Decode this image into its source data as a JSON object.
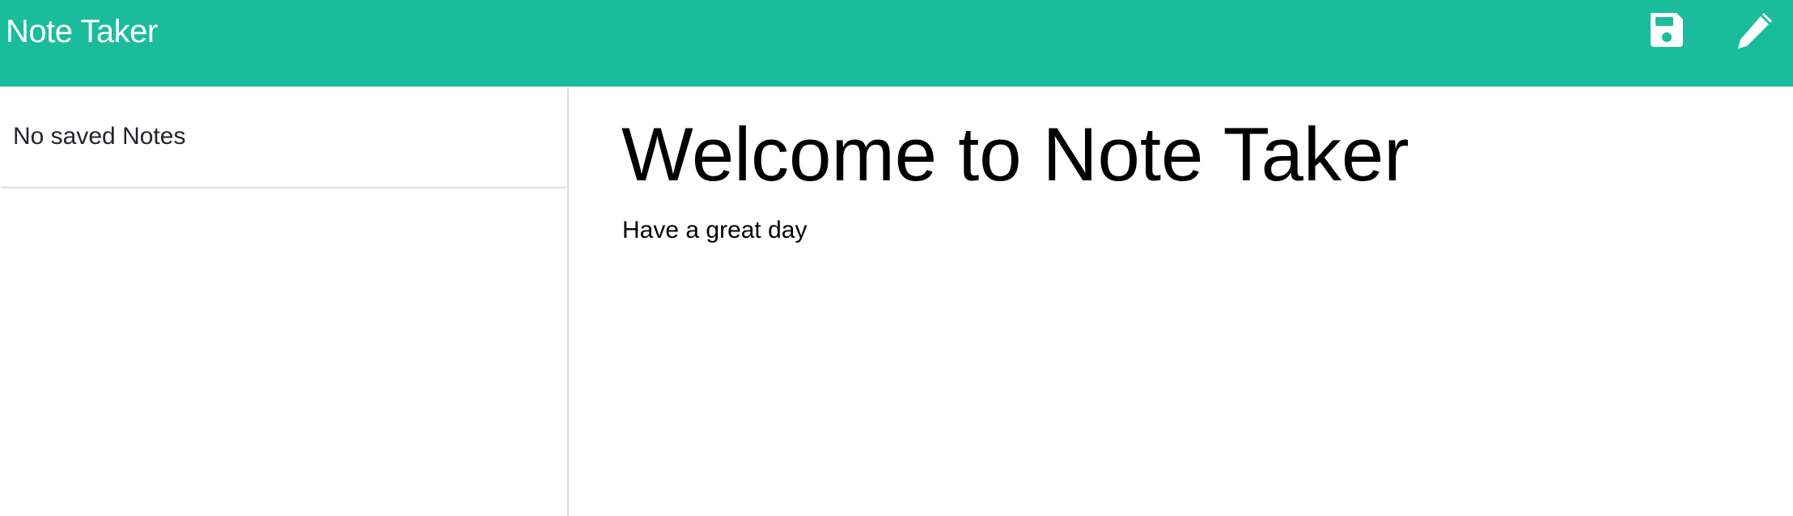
{
  "app": {
    "title": "Note Taker"
  },
  "toolbar": {
    "save_icon": "save-icon",
    "new_note_icon": "pencil-icon"
  },
  "sidebar": {
    "empty_message": "No saved Notes"
  },
  "main": {
    "heading": "Welcome to Note Taker",
    "subheading": "Have a great day"
  },
  "colors": {
    "navbar": "#1abc9c",
    "icon": "#ffffff",
    "divider": "#dddddd",
    "text": "#000000"
  }
}
